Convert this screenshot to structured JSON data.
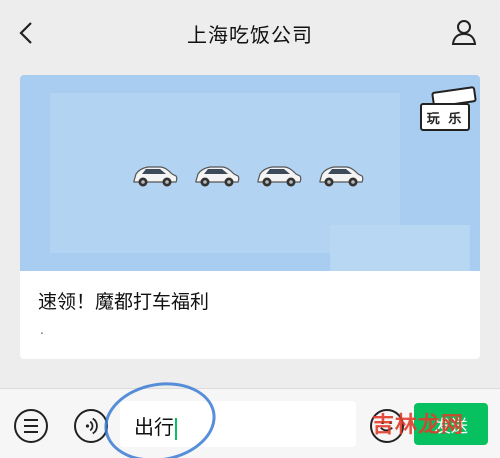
{
  "header": {
    "title": "上海吃饭公司",
    "back_icon": "chevron-left-icon",
    "profile_icon": "person-icon"
  },
  "card": {
    "badge": "玩 乐",
    "title": "速领！魔都打车福利",
    "subtitle": ".",
    "banner_color": "#a9cdf0"
  },
  "input_bar": {
    "menu_icon": "menu-list-icon",
    "voice_icon": "voice-icon",
    "input_value": "出行",
    "emoji_icon": "emoji-icon",
    "send_label": "发送",
    "send_color": "#07c160"
  },
  "watermark": "吉林龙网"
}
